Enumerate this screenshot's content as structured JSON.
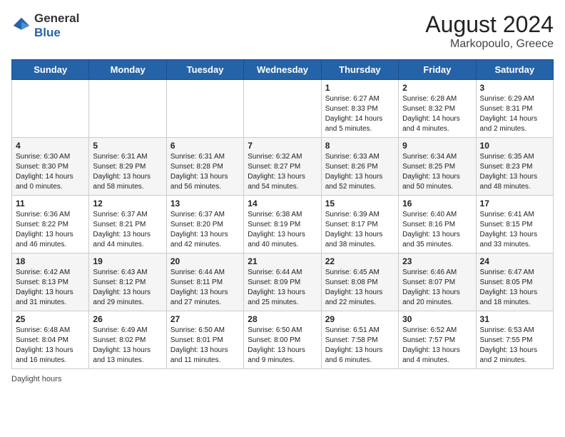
{
  "header": {
    "logo_general": "General",
    "logo_blue": "Blue",
    "month_year": "August 2024",
    "location": "Markopoulo, Greece"
  },
  "days_of_week": [
    "Sunday",
    "Monday",
    "Tuesday",
    "Wednesday",
    "Thursday",
    "Friday",
    "Saturday"
  ],
  "weeks": [
    [
      {
        "num": "",
        "info": ""
      },
      {
        "num": "",
        "info": ""
      },
      {
        "num": "",
        "info": ""
      },
      {
        "num": "",
        "info": ""
      },
      {
        "num": "1",
        "info": "Sunrise: 6:27 AM\nSunset: 8:33 PM\nDaylight: 14 hours and 5 minutes."
      },
      {
        "num": "2",
        "info": "Sunrise: 6:28 AM\nSunset: 8:32 PM\nDaylight: 14 hours and 4 minutes."
      },
      {
        "num": "3",
        "info": "Sunrise: 6:29 AM\nSunset: 8:31 PM\nDaylight: 14 hours and 2 minutes."
      }
    ],
    [
      {
        "num": "4",
        "info": "Sunrise: 6:30 AM\nSunset: 8:30 PM\nDaylight: 14 hours and 0 minutes."
      },
      {
        "num": "5",
        "info": "Sunrise: 6:31 AM\nSunset: 8:29 PM\nDaylight: 13 hours and 58 minutes."
      },
      {
        "num": "6",
        "info": "Sunrise: 6:31 AM\nSunset: 8:28 PM\nDaylight: 13 hours and 56 minutes."
      },
      {
        "num": "7",
        "info": "Sunrise: 6:32 AM\nSunset: 8:27 PM\nDaylight: 13 hours and 54 minutes."
      },
      {
        "num": "8",
        "info": "Sunrise: 6:33 AM\nSunset: 8:26 PM\nDaylight: 13 hours and 52 minutes."
      },
      {
        "num": "9",
        "info": "Sunrise: 6:34 AM\nSunset: 8:25 PM\nDaylight: 13 hours and 50 minutes."
      },
      {
        "num": "10",
        "info": "Sunrise: 6:35 AM\nSunset: 8:23 PM\nDaylight: 13 hours and 48 minutes."
      }
    ],
    [
      {
        "num": "11",
        "info": "Sunrise: 6:36 AM\nSunset: 8:22 PM\nDaylight: 13 hours and 46 minutes."
      },
      {
        "num": "12",
        "info": "Sunrise: 6:37 AM\nSunset: 8:21 PM\nDaylight: 13 hours and 44 minutes."
      },
      {
        "num": "13",
        "info": "Sunrise: 6:37 AM\nSunset: 8:20 PM\nDaylight: 13 hours and 42 minutes."
      },
      {
        "num": "14",
        "info": "Sunrise: 6:38 AM\nSunset: 8:19 PM\nDaylight: 13 hours and 40 minutes."
      },
      {
        "num": "15",
        "info": "Sunrise: 6:39 AM\nSunset: 8:17 PM\nDaylight: 13 hours and 38 minutes."
      },
      {
        "num": "16",
        "info": "Sunrise: 6:40 AM\nSunset: 8:16 PM\nDaylight: 13 hours and 35 minutes."
      },
      {
        "num": "17",
        "info": "Sunrise: 6:41 AM\nSunset: 8:15 PM\nDaylight: 13 hours and 33 minutes."
      }
    ],
    [
      {
        "num": "18",
        "info": "Sunrise: 6:42 AM\nSunset: 8:13 PM\nDaylight: 13 hours and 31 minutes."
      },
      {
        "num": "19",
        "info": "Sunrise: 6:43 AM\nSunset: 8:12 PM\nDaylight: 13 hours and 29 minutes."
      },
      {
        "num": "20",
        "info": "Sunrise: 6:44 AM\nSunset: 8:11 PM\nDaylight: 13 hours and 27 minutes."
      },
      {
        "num": "21",
        "info": "Sunrise: 6:44 AM\nSunset: 8:09 PM\nDaylight: 13 hours and 25 minutes."
      },
      {
        "num": "22",
        "info": "Sunrise: 6:45 AM\nSunset: 8:08 PM\nDaylight: 13 hours and 22 minutes."
      },
      {
        "num": "23",
        "info": "Sunrise: 6:46 AM\nSunset: 8:07 PM\nDaylight: 13 hours and 20 minutes."
      },
      {
        "num": "24",
        "info": "Sunrise: 6:47 AM\nSunset: 8:05 PM\nDaylight: 13 hours and 18 minutes."
      }
    ],
    [
      {
        "num": "25",
        "info": "Sunrise: 6:48 AM\nSunset: 8:04 PM\nDaylight: 13 hours and 16 minutes."
      },
      {
        "num": "26",
        "info": "Sunrise: 6:49 AM\nSunset: 8:02 PM\nDaylight: 13 hours and 13 minutes."
      },
      {
        "num": "27",
        "info": "Sunrise: 6:50 AM\nSunset: 8:01 PM\nDaylight: 13 hours and 11 minutes."
      },
      {
        "num": "28",
        "info": "Sunrise: 6:50 AM\nSunset: 8:00 PM\nDaylight: 13 hours and 9 minutes."
      },
      {
        "num": "29",
        "info": "Sunrise: 6:51 AM\nSunset: 7:58 PM\nDaylight: 13 hours and 6 minutes."
      },
      {
        "num": "30",
        "info": "Sunrise: 6:52 AM\nSunset: 7:57 PM\nDaylight: 13 hours and 4 minutes."
      },
      {
        "num": "31",
        "info": "Sunrise: 6:53 AM\nSunset: 7:55 PM\nDaylight: 13 hours and 2 minutes."
      }
    ]
  ],
  "footer": {
    "daylight_label": "Daylight hours"
  }
}
